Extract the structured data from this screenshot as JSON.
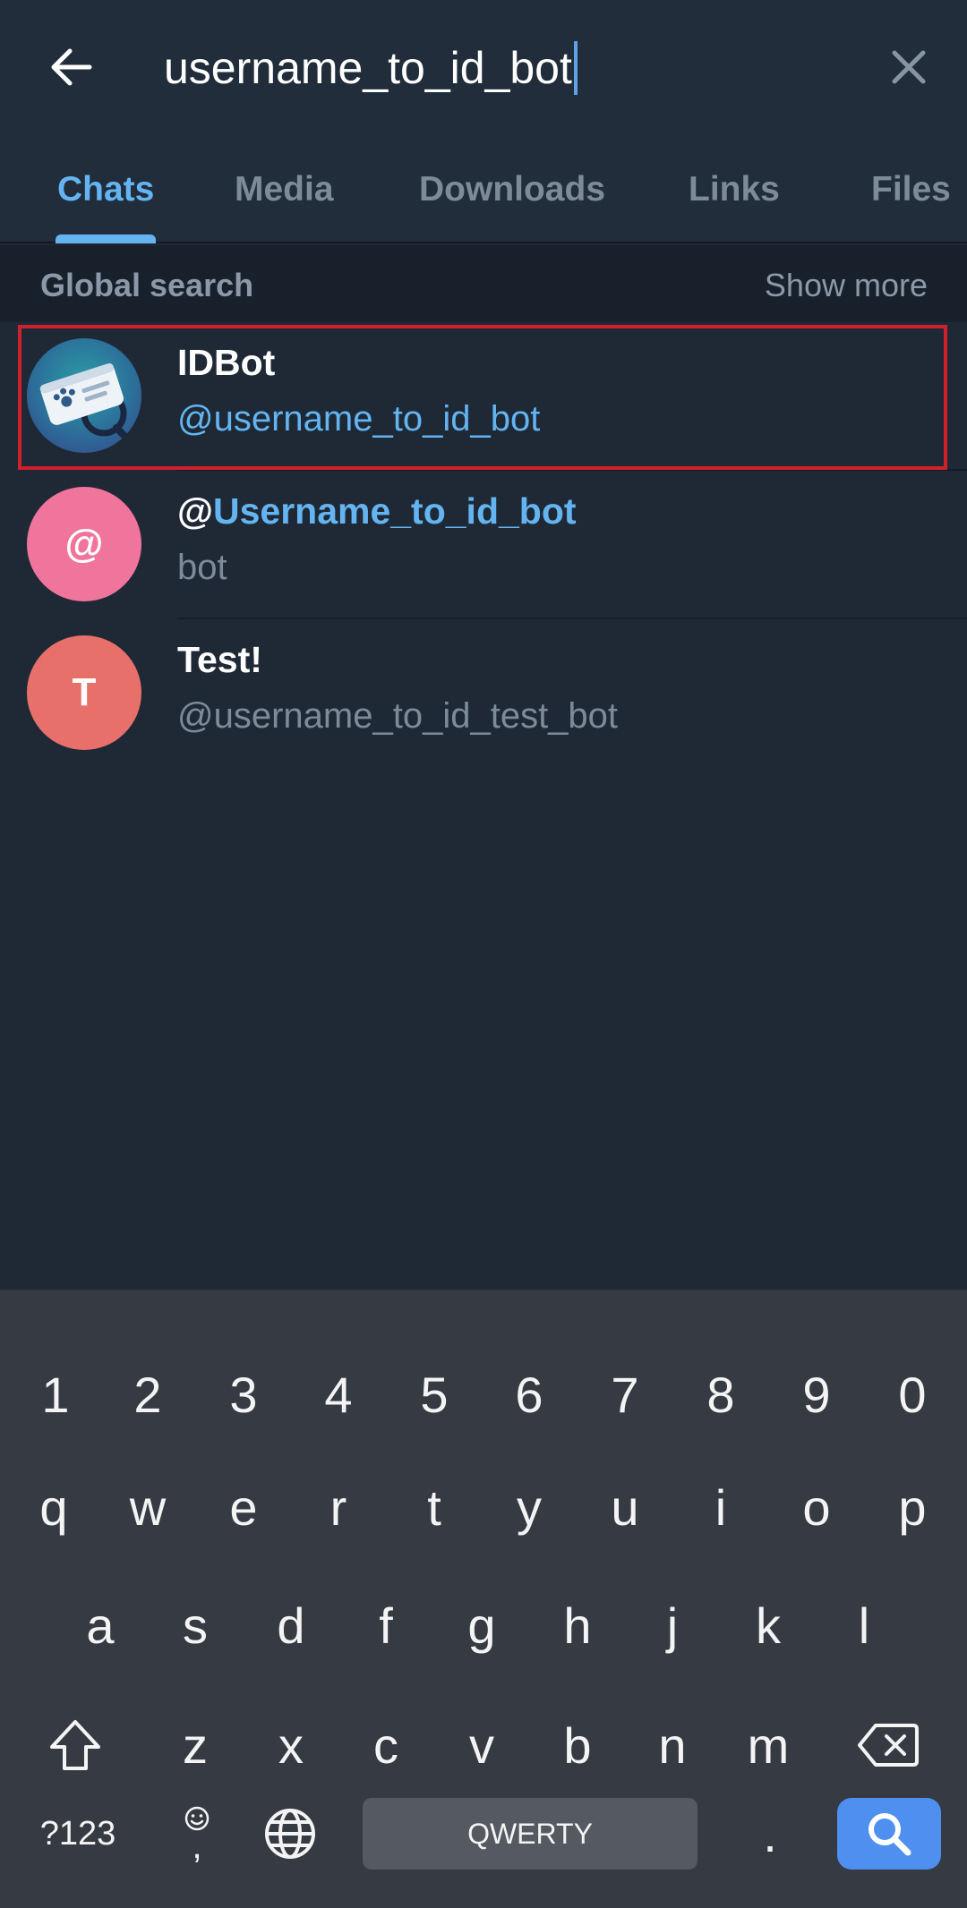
{
  "search": {
    "query": "username_to_id_bot"
  },
  "tabs": [
    {
      "label": "Chats",
      "active": true
    },
    {
      "label": "Media",
      "active": false
    },
    {
      "label": "Downloads",
      "active": false
    },
    {
      "label": "Links",
      "active": false
    },
    {
      "label": "Files",
      "active": false
    }
  ],
  "section": {
    "title": "Global search",
    "action": "Show more"
  },
  "results": [
    {
      "name": "IDBot",
      "subtitle": "@username_to_id_bot",
      "avatar_icon": "id-card-magnifier-icon",
      "selected": true
    },
    {
      "name_prefix": "@",
      "name_highlight": "Username_to_id_bot",
      "subtitle": "bot",
      "avatar_letter": "@",
      "avatar_color": "#f0759c"
    },
    {
      "name": "Test!",
      "subtitle": "@username_to_id_test_bot",
      "avatar_letter": "T",
      "avatar_color": "#e8706a"
    }
  ],
  "keyboard": {
    "row_numbers": [
      "1",
      "2",
      "3",
      "4",
      "5",
      "6",
      "7",
      "8",
      "9",
      "0"
    ],
    "row1": [
      "q",
      "w",
      "e",
      "r",
      "t",
      "y",
      "u",
      "i",
      "o",
      "p"
    ],
    "row2": [
      "a",
      "s",
      "d",
      "f",
      "g",
      "h",
      "j",
      "k",
      "l"
    ],
    "row3": [
      "z",
      "x",
      "c",
      "v",
      "b",
      "n",
      "m"
    ],
    "symbols_label": "?123",
    "comma_label": ",",
    "space_label": "QWERTY",
    "period_label": ".",
    "shift_icon": "shift-icon",
    "backspace_icon": "backspace-icon",
    "globe_icon": "globe-icon",
    "emoji_icon": "emoji-icon",
    "search_icon": "search-icon"
  },
  "colors": {
    "accent": "#63b4f0",
    "background": "#1f2936",
    "selection_border": "#d0202c",
    "search_key": "#4f8ff0"
  }
}
